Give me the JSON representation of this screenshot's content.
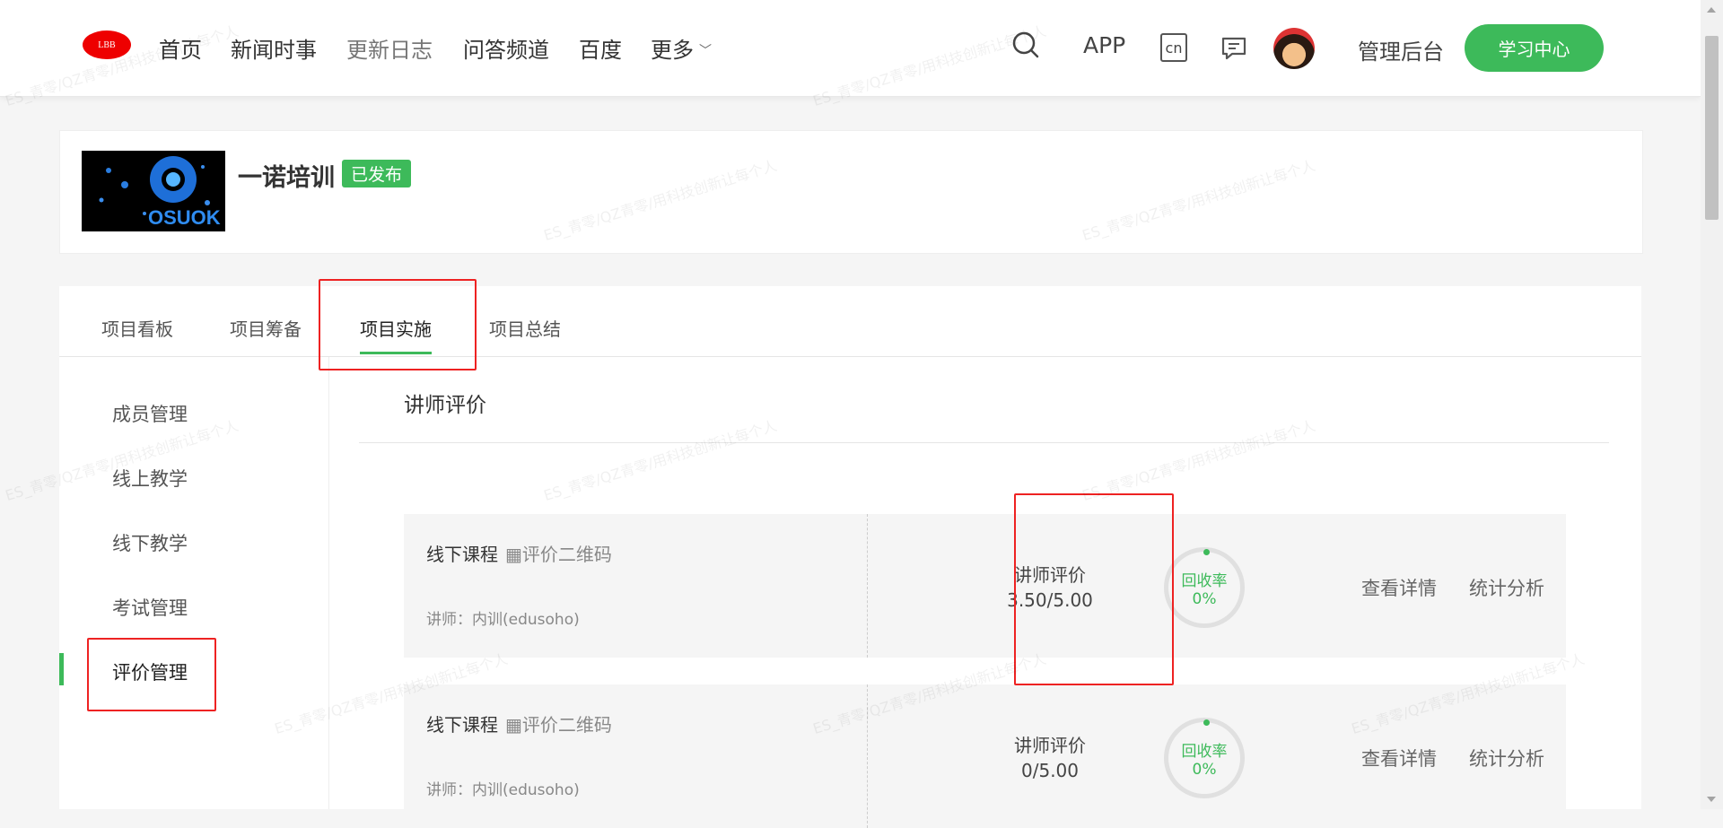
{
  "header": {
    "logo_text": "LBB",
    "nav": [
      "首页",
      "新闻时事",
      "更新日志",
      "问答频道",
      "百度",
      "更多"
    ],
    "app_label": "APP",
    "lang_label": "cn",
    "admin_label": "管理后台",
    "learn_center_label": "学习中心"
  },
  "project": {
    "title": "一诺培训",
    "status": "已发布",
    "cover_text": "OSUOK"
  },
  "tabs": [
    "项目看板",
    "项目筹备",
    "项目实施",
    "项目总结"
  ],
  "active_tab": "项目实施",
  "sidebar": {
    "items": [
      "成员管理",
      "线上教学",
      "线下教学",
      "考试管理",
      "评价管理"
    ],
    "active": "评价管理"
  },
  "section": {
    "title": "讲师评价"
  },
  "evaluations": [
    {
      "course": "线下课程",
      "qr_label": "评价二维码",
      "teacher": "讲师：内训(edusoho)",
      "score_label": "讲师评价",
      "score": "3.50/5.00",
      "recovery_label": "回收率",
      "recovery_rate": "0%",
      "detail_label": "查看详情",
      "stats_label": "统计分析"
    },
    {
      "course": "线下课程",
      "qr_label": "评价二维码",
      "teacher": "讲师：内训(edusoho)",
      "score_label": "讲师评价",
      "score": "0/5.00",
      "recovery_label": "回收率",
      "recovery_rate": "0%",
      "detail_label": "查看详情",
      "stats_label": "统计分析"
    }
  ],
  "watermark": "ES_青零/QZ青零/用科技创新让每个人",
  "colors": {
    "accent": "#3dba5a",
    "annotation": "#e22222",
    "logo": "#ee0000"
  }
}
